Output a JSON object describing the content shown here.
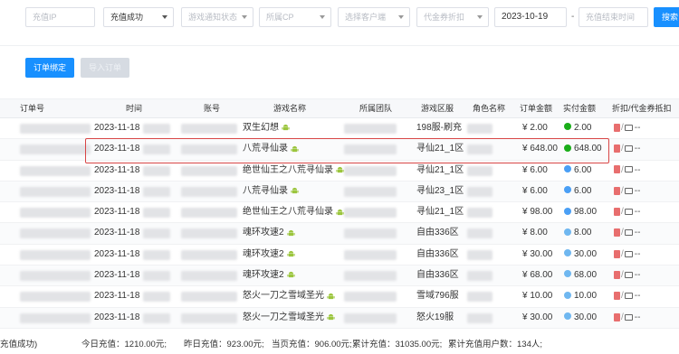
{
  "filters": {
    "ip_placeholder": "充值IP",
    "status_value": "充值成功",
    "notify_placeholder": "游戏通知状态",
    "cp_placeholder": "所属CP",
    "customer_placeholder": "选择客户端",
    "voucher_placeholder": "代金券折扣",
    "start_date": "2023-10-19",
    "date_separator": "-",
    "end_placeholder": "充值结束时间",
    "search_label": "搜索"
  },
  "actions": {
    "bind_order": "订单绑定",
    "import_order": "导入订单"
  },
  "table": {
    "headers": {
      "order_no": "订单号",
      "time": "时间",
      "account": "账号",
      "game": "游戏名称",
      "team": "所属团队",
      "server": "游戏区服",
      "role": "角色名称",
      "amount": "订单金额",
      "paid": "实付金额",
      "discount": "折扣/代金券抵扣"
    },
    "rows": [
      {
        "date": "2023-11-18",
        "game": "双生幻想",
        "server": "198服-刷充",
        "amount": "¥ 2.00",
        "paid": "2.00",
        "pay": "green"
      },
      {
        "date": "2023-11-18",
        "game": "八荒寻仙录",
        "server": "寻仙21_1区",
        "amount": "¥ 648.00",
        "paid": "648.00",
        "pay": "green"
      },
      {
        "date": "2023-11-18",
        "game": "绝世仙王之八荒寻仙录",
        "server": "寻仙21_1区",
        "amount": "¥ 6.00",
        "paid": "6.00",
        "pay": "blue"
      },
      {
        "date": "2023-11-18",
        "game": "八荒寻仙录",
        "server": "寻仙23_1区",
        "amount": "¥ 6.00",
        "paid": "6.00",
        "pay": "blue"
      },
      {
        "date": "2023-11-18",
        "game": "绝世仙王之八荒寻仙录",
        "server": "寻仙21_1区",
        "amount": "¥ 98.00",
        "paid": "98.00",
        "pay": "blue"
      },
      {
        "date": "2023-11-18",
        "game": "魂环攻速2",
        "server": "自由336区",
        "amount": "¥ 8.00",
        "paid": "8.00",
        "pay": "sky"
      },
      {
        "date": "2023-11-18",
        "game": "魂环攻速2",
        "server": "自由336区",
        "amount": "¥ 30.00",
        "paid": "30.00",
        "pay": "sky"
      },
      {
        "date": "2023-11-18",
        "game": "魂环攻速2",
        "server": "自由336区",
        "amount": "¥ 68.00",
        "paid": "68.00",
        "pay": "sky"
      },
      {
        "date": "2023-11-18",
        "game": "怒火一刀之雪域圣光",
        "server": "雪域796服",
        "amount": "¥ 10.00",
        "paid": "10.00",
        "pay": "sky"
      },
      {
        "date": "2023-11-18",
        "game": "怒火一刀之雪域圣光",
        "server": "怒火19服",
        "amount": "¥ 30.00",
        "paid": "30.00",
        "pay": "sky"
      }
    ]
  },
  "footer": {
    "status": "充值成功)",
    "today": "今日充值：1210.00元;",
    "yesterday": "昨日充值：923.00元;",
    "current_page": "当页充值：906.00元;",
    "total": "累计充值：31035.00元;",
    "users": "累计充值用户数：134人;"
  },
  "colors": {
    "primary": "#1890ff",
    "highlight": "#d84545",
    "wechat_pay": "#1aad19",
    "alipay": "#4a9ff5"
  }
}
